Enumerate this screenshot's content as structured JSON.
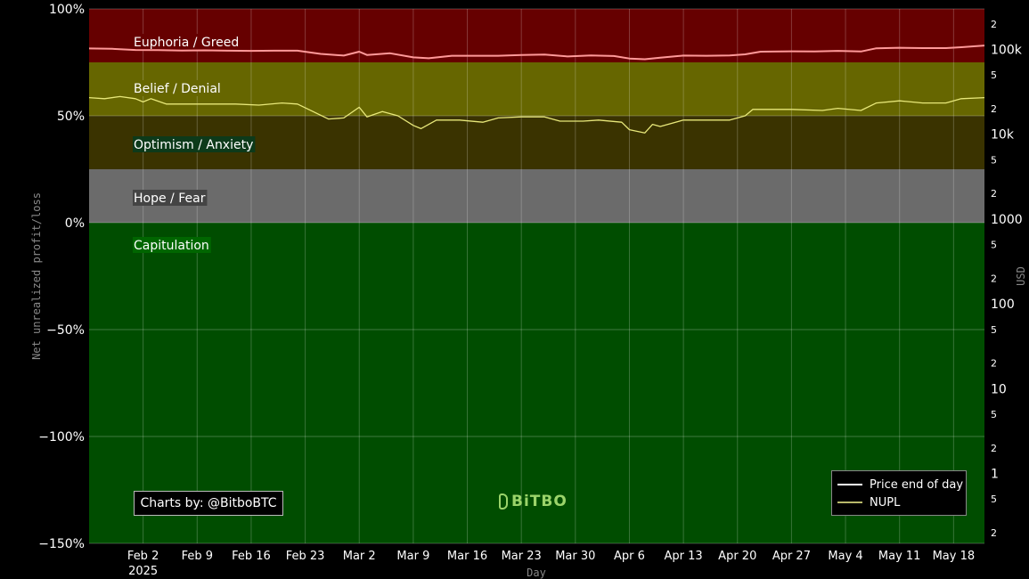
{
  "chart_data": {
    "type": "line",
    "xlabel": "Day",
    "ylabel_left": "Net unrealized profit/loss",
    "ylabel_right": "USD",
    "x_range": [
      "2025-01-26",
      "2025-05-22"
    ],
    "y_left_range": [
      -150,
      100
    ],
    "y_left_ticks": [
      {
        "value": 100,
        "label": "100%"
      },
      {
        "value": 50,
        "label": "50%"
      },
      {
        "value": 0,
        "label": "0%"
      },
      {
        "value": -50,
        "label": "−50%"
      },
      {
        "value": -100,
        "label": "−100%"
      },
      {
        "value": -150,
        "label": "−150%"
      }
    ],
    "y_right_scale": "log",
    "y_right_range": [
      0.15,
      300000
    ],
    "y_right_ticks_major": [
      {
        "value": 100000,
        "label": "100k"
      },
      {
        "value": 10000,
        "label": "10k"
      },
      {
        "value": 1000,
        "label": "1000"
      },
      {
        "value": 100,
        "label": "100"
      },
      {
        "value": 10,
        "label": "10"
      },
      {
        "value": 1,
        "label": "1"
      }
    ],
    "y_right_ticks_minor": [
      {
        "value": 200000,
        "label": "2"
      },
      {
        "value": 50000,
        "label": "5"
      },
      {
        "value": 20000,
        "label": "2"
      },
      {
        "value": 5000,
        "label": "5"
      },
      {
        "value": 2000,
        "label": "2"
      },
      {
        "value": 500,
        "label": "5"
      },
      {
        "value": 200,
        "label": "2"
      },
      {
        "value": 50,
        "label": "5"
      },
      {
        "value": 20,
        "label": "2"
      },
      {
        "value": 5,
        "label": "5"
      },
      {
        "value": 2,
        "label": "2"
      },
      {
        "value": 0.5,
        "label": "5"
      },
      {
        "value": 0.2,
        "label": "2"
      }
    ],
    "x_ticks": [
      {
        "date": "2025-02-02",
        "label": "Feb 2",
        "sublabel": "2025"
      },
      {
        "date": "2025-02-09",
        "label": "Feb 9"
      },
      {
        "date": "2025-02-16",
        "label": "Feb 16"
      },
      {
        "date": "2025-02-23",
        "label": "Feb 23"
      },
      {
        "date": "2025-03-02",
        "label": "Mar 2"
      },
      {
        "date": "2025-03-09",
        "label": "Mar 9"
      },
      {
        "date": "2025-03-16",
        "label": "Mar 16"
      },
      {
        "date": "2025-03-23",
        "label": "Mar 23"
      },
      {
        "date": "2025-03-30",
        "label": "Mar 30"
      },
      {
        "date": "2025-04-06",
        "label": "Apr 6"
      },
      {
        "date": "2025-04-13",
        "label": "Apr 13"
      },
      {
        "date": "2025-04-20",
        "label": "Apr 20"
      },
      {
        "date": "2025-04-27",
        "label": "Apr 27"
      },
      {
        "date": "2025-05-04",
        "label": "May 4"
      },
      {
        "date": "2025-05-11",
        "label": "May 11"
      },
      {
        "date": "2025-05-18",
        "label": "May 18"
      }
    ],
    "zones": [
      {
        "label": "Euphoria / Greed",
        "from": 75,
        "to": 100,
        "color": "#660000",
        "label_bg": "#660000"
      },
      {
        "label": "Belief / Denial",
        "from": 50,
        "to": 75,
        "color": "#666600",
        "label_bg": "#666600"
      },
      {
        "label": "Optimism / Anxiety",
        "from": 25,
        "to": 50,
        "color": "#3a3300",
        "label_bg": "#0d3a1a"
      },
      {
        "label": "Hope / Fear",
        "from": 0,
        "to": 25,
        "color": "#6b6b6b",
        "label_bg": "#444444"
      },
      {
        "label": "Capitulation",
        "from": -150,
        "to": 0,
        "color": "#004d00",
        "label_bg": "#006600"
      }
    ],
    "series": [
      {
        "name": "Price end of day",
        "axis": "right",
        "color": "#ff9999",
        "points": [
          [
            "2025-01-26",
            102500
          ],
          [
            "2025-01-29",
            101500
          ],
          [
            "2025-02-01",
            98500
          ],
          [
            "2025-02-04",
            98000
          ],
          [
            "2025-02-07",
            97000
          ],
          [
            "2025-02-10",
            97500
          ],
          [
            "2025-02-13",
            96500
          ],
          [
            "2025-02-16",
            96000
          ],
          [
            "2025-02-19",
            96500
          ],
          [
            "2025-02-22",
            96500
          ],
          [
            "2025-02-25",
            88500
          ],
          [
            "2025-02-28",
            84500
          ],
          [
            "2025-03-02",
            94000
          ],
          [
            "2025-03-03",
            86000
          ],
          [
            "2025-03-06",
            90000
          ],
          [
            "2025-03-09",
            80500
          ],
          [
            "2025-03-11",
            78500
          ],
          [
            "2025-03-14",
            84000
          ],
          [
            "2025-03-17",
            84000
          ],
          [
            "2025-03-20",
            84000
          ],
          [
            "2025-03-23",
            86000
          ],
          [
            "2025-03-26",
            87000
          ],
          [
            "2025-03-29",
            82500
          ],
          [
            "2025-04-01",
            85000
          ],
          [
            "2025-04-04",
            83500
          ],
          [
            "2025-04-06",
            78000
          ],
          [
            "2025-04-08",
            76500
          ],
          [
            "2025-04-10",
            80000
          ],
          [
            "2025-04-13",
            84500
          ],
          [
            "2025-04-16",
            84000
          ],
          [
            "2025-04-19",
            85000
          ],
          [
            "2025-04-21",
            87500
          ],
          [
            "2025-04-23",
            94000
          ],
          [
            "2025-04-27",
            95000
          ],
          [
            "2025-04-30",
            94500
          ],
          [
            "2025-05-03",
            96000
          ],
          [
            "2025-05-06",
            94500
          ],
          [
            "2025-05-08",
            103000
          ],
          [
            "2025-05-11",
            104500
          ],
          [
            "2025-05-14",
            103500
          ],
          [
            "2025-05-17",
            103500
          ],
          [
            "2025-05-19",
            106000
          ],
          [
            "2025-05-22",
            111000
          ]
        ]
      },
      {
        "name": "NUPL",
        "axis": "left",
        "color": "#e8e87a",
        "points": [
          [
            "2025-01-26",
            58.5
          ],
          [
            "2025-01-28",
            58
          ],
          [
            "2025-01-30",
            59
          ],
          [
            "2025-02-01",
            58
          ],
          [
            "2025-02-02",
            56.5
          ],
          [
            "2025-02-03",
            58
          ],
          [
            "2025-02-05",
            55.5
          ],
          [
            "2025-02-08",
            55.5
          ],
          [
            "2025-02-11",
            55.5
          ],
          [
            "2025-02-14",
            55.5
          ],
          [
            "2025-02-17",
            55
          ],
          [
            "2025-02-20",
            56
          ],
          [
            "2025-02-22",
            55.5
          ],
          [
            "2025-02-24",
            52
          ],
          [
            "2025-02-26",
            48.5
          ],
          [
            "2025-02-28",
            49
          ],
          [
            "2025-03-02",
            54
          ],
          [
            "2025-03-03",
            49.5
          ],
          [
            "2025-03-05",
            52
          ],
          [
            "2025-03-07",
            50
          ],
          [
            "2025-03-09",
            45.5
          ],
          [
            "2025-03-10",
            44
          ],
          [
            "2025-03-12",
            48
          ],
          [
            "2025-03-15",
            48
          ],
          [
            "2025-03-18",
            47
          ],
          [
            "2025-03-20",
            49
          ],
          [
            "2025-03-23",
            49.5
          ],
          [
            "2025-03-26",
            49.5
          ],
          [
            "2025-03-28",
            47.5
          ],
          [
            "2025-03-31",
            47.5
          ],
          [
            "2025-04-02",
            48
          ],
          [
            "2025-04-05",
            47
          ],
          [
            "2025-04-06",
            43.5
          ],
          [
            "2025-04-08",
            42
          ],
          [
            "2025-04-09",
            46
          ],
          [
            "2025-04-10",
            45
          ],
          [
            "2025-04-13",
            48
          ],
          [
            "2025-04-16",
            48
          ],
          [
            "2025-04-19",
            48
          ],
          [
            "2025-04-21",
            50
          ],
          [
            "2025-04-22",
            53
          ],
          [
            "2025-04-27",
            53
          ],
          [
            "2025-05-01",
            52.5
          ],
          [
            "2025-05-03",
            53.5
          ],
          [
            "2025-05-06",
            52.5
          ],
          [
            "2025-05-08",
            56
          ],
          [
            "2025-05-11",
            57
          ],
          [
            "2025-05-14",
            56
          ],
          [
            "2025-05-17",
            56
          ],
          [
            "2025-05-19",
            58
          ],
          [
            "2025-05-22",
            58.5
          ]
        ]
      }
    ],
    "grid": true,
    "legend_position": "bottom-right"
  },
  "legend": {
    "items": [
      {
        "label": "Price end of day",
        "color": "#ffffff"
      },
      {
        "label": "NUPL",
        "color": "#b8b86a"
      }
    ]
  },
  "credit": "Charts by: @BitboBTC",
  "logo": "BiTBO"
}
